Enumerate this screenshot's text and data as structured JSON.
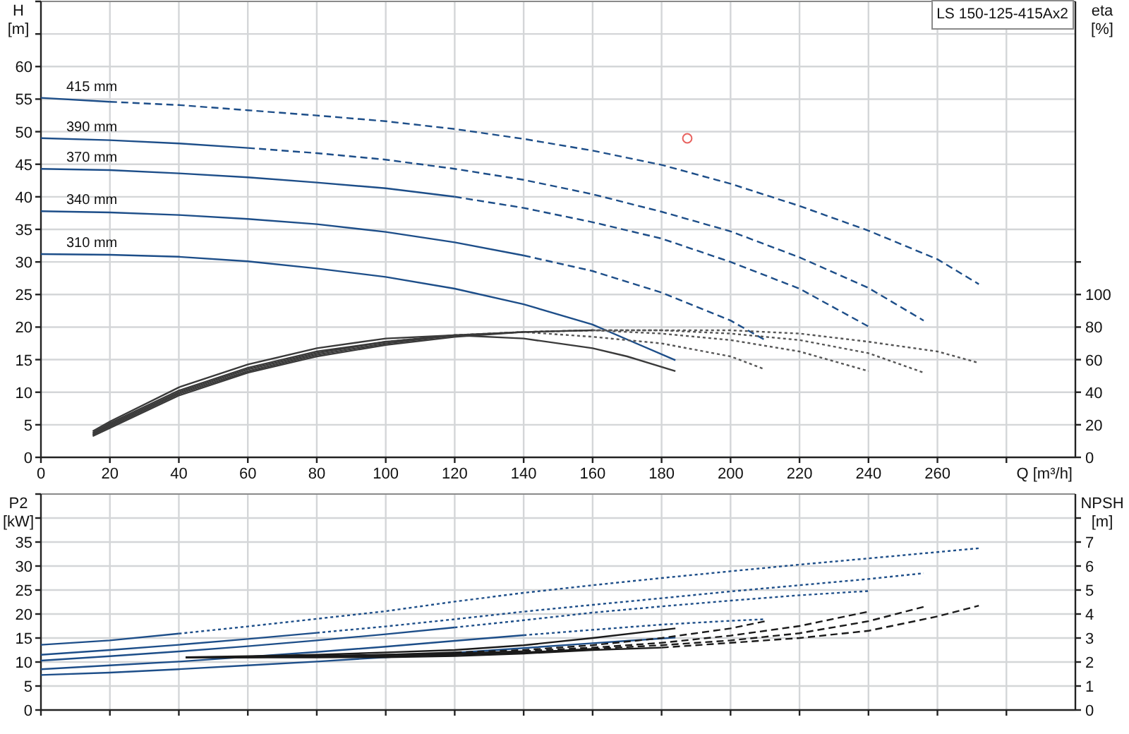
{
  "legend": "LS 150-125-415Ax2",
  "panels": [
    {
      "charts": [
        {
          "chart_data": {
            "type": "line",
            "xlabel": "Q [m³/h]",
            "ylabel": "H [m]",
            "grid": true,
            "xlim": [
              0,
              300
            ],
            "ylim": [
              0,
              70
            ],
            "xticks": [
              0,
              20,
              40,
              60,
              80,
              100,
              120,
              140,
              160,
              180,
              200,
              220,
              240,
              260
            ],
            "yticks": [
              0,
              5,
              10,
              15,
              20,
              25,
              30,
              35,
              40,
              45,
              50,
              55,
              60
            ],
            "series": [
              {
                "name": "415 mm",
                "color": "#1d4e89",
                "line_style": "solid",
                "x": [
                  0,
                  20
                ],
                "values": [
                  55.2,
                  54.6
                ]
              },
              {
                "color": "#1d4e89",
                "line_style": "dashed",
                "x": [
                  20,
                  40,
                  60,
                  80,
                  100,
                  120,
                  140,
                  160,
                  180,
                  200,
                  220,
                  240,
                  260,
                  272
                ],
                "values": [
                  54.6,
                  54.1,
                  53.3,
                  52.5,
                  51.6,
                  50.4,
                  48.9,
                  47.1,
                  44.9,
                  42.0,
                  38.6,
                  34.8,
                  30.4,
                  26.6
                ]
              },
              {
                "name": "390 mm",
                "color": "#1d4e89",
                "line_style": "solid",
                "x": [
                  0,
                  20,
                  40,
                  60
                ],
                "values": [
                  49.0,
                  48.7,
                  48.2,
                  47.5
                ]
              },
              {
                "color": "#1d4e89",
                "line_style": "dashed",
                "x": [
                  60,
                  80,
                  100,
                  120,
                  140,
                  160,
                  180,
                  200,
                  220,
                  240,
                  256
                ],
                "values": [
                  47.5,
                  46.7,
                  45.7,
                  44.3,
                  42.6,
                  40.4,
                  37.7,
                  34.7,
                  30.7,
                  26.0,
                  21.0
                ]
              },
              {
                "name": "370 mm",
                "color": "#1d4e89",
                "line_style": "solid",
                "x": [
                  0,
                  20,
                  40,
                  60,
                  80,
                  100,
                  120
                ],
                "values": [
                  44.3,
                  44.1,
                  43.6,
                  43.0,
                  42.2,
                  41.3,
                  40.0
                ]
              },
              {
                "color": "#1d4e89",
                "line_style": "dashed",
                "x": [
                  120,
                  140,
                  160,
                  180,
                  200,
                  220,
                  240
                ],
                "values": [
                  40.0,
                  38.3,
                  36.1,
                  33.6,
                  30.0,
                  25.9,
                  20.1
                ]
              },
              {
                "name": "340 mm",
                "color": "#1d4e89",
                "line_style": "solid",
                "x": [
                  0,
                  20,
                  40,
                  60,
                  80,
                  100,
                  120,
                  140
                ],
                "values": [
                  37.8,
                  37.6,
                  37.2,
                  36.6,
                  35.8,
                  34.6,
                  33.0,
                  31.0
                ]
              },
              {
                "color": "#1d4e89",
                "line_style": "dashed",
                "x": [
                  140,
                  160,
                  180,
                  200,
                  210
                ],
                "values": [
                  31.0,
                  28.6,
                  25.3,
                  21.0,
                  18.0
                ]
              },
              {
                "name": "310 mm",
                "color": "#1d4e89",
                "line_style": "solid",
                "x": [
                  0,
                  20,
                  40,
                  60,
                  80,
                  100,
                  120,
                  140,
                  160,
                  170,
                  184
                ],
                "values": [
                  31.2,
                  31.1,
                  30.8,
                  30.1,
                  29.0,
                  27.7,
                  25.9,
                  23.5,
                  20.4,
                  18.1,
                  14.9
                ]
              }
            ]
          }
        },
        {
          "chart_data": {
            "type": "line",
            "ylabel": "eta [%]",
            "xlim": [
              0,
              300
            ],
            "ylim": [
              0,
              280
            ],
            "yticks": [
              0,
              20,
              40,
              60,
              80,
              100
            ],
            "series": [
              {
                "color": "#3a3a3a",
                "line_style": "solid",
                "x": [
                  15,
                  20,
                  40,
                  60,
                  80,
                  100,
                  120,
                  140,
                  160,
                  170,
                  184
                ],
                "values": [
                  16,
                  22,
                  43,
                  57,
                  67,
                  73,
                  75,
                  73,
                  67,
                  62,
                  53
                ]
              },
              {
                "color": "#3a3a3a",
                "line_style": "solid",
                "x": [
                  15,
                  20,
                  40,
                  60,
                  80,
                  100
                ],
                "values": [
                  15,
                  21,
                  41,
                  55,
                  65,
                  71
                ]
              },
              {
                "color": "#555555",
                "line_style": "dotted",
                "x": [
                  100,
                  120,
                  140,
                  160,
                  180,
                  200,
                  210
                ],
                "values": [
                  71,
                  75,
                  77,
                  74,
                  70,
                  62,
                  54
                ]
              },
              {
                "color": "#3a3a3a",
                "line_style": "solid",
                "x": [
                  15,
                  20,
                  40,
                  60,
                  80,
                  100,
                  120
                ],
                "values": [
                  14,
                  20,
                  40,
                  54,
                  64,
                  71,
                  75
                ]
              },
              {
                "color": "#555555",
                "line_style": "dotted",
                "x": [
                  120,
                  140,
                  160,
                  180,
                  200,
                  220,
                  240
                ],
                "values": [
                  75,
                  77,
                  78,
                  76,
                  72,
                  65,
                  53
                ]
              },
              {
                "color": "#3a3a3a",
                "line_style": "solid",
                "x": [
                  15,
                  20,
                  40,
                  60,
                  80,
                  100,
                  120,
                  140
                ],
                "values": [
                  14,
                  19,
                  39,
                  53,
                  63,
                  70,
                  75,
                  77
                ]
              },
              {
                "color": "#555555",
                "line_style": "dotted",
                "x": [
                  140,
                  160,
                  180,
                  200,
                  220,
                  240,
                  256
                ],
                "values": [
                  77,
                  78,
                  78,
                  76,
                  72,
                  64,
                  52
                ]
              },
              {
                "color": "#3a3a3a",
                "line_style": "solid",
                "x": [
                  15,
                  20,
                  40,
                  60,
                  80,
                  100,
                  120,
                  140,
                  160
                ],
                "values": [
                  13,
                  18,
                  38,
                  52,
                  62,
                  69,
                  74,
                  77,
                  78
                ]
              },
              {
                "color": "#555555",
                "line_style": "dotted",
                "x": [
                  160,
                  180,
                  200,
                  220,
                  240,
                  260,
                  272
                ],
                "values": [
                  78,
                  78,
                  78,
                  76,
                  71,
                  65,
                  58
                ]
              }
            ]
          }
        }
      ]
    },
    {
      "charts": [
        {
          "chart_data": {
            "type": "line",
            "ylabel": "P2 [kW]",
            "grid": true,
            "xlim": [
              0,
              300
            ],
            "ylim": [
              0,
              45
            ],
            "yticks": [
              0,
              5,
              10,
              15,
              20,
              25,
              30,
              35
            ],
            "series": [
              {
                "color": "#1d4e89",
                "line_style": "solid",
                "x": [
                  0,
                  20,
                  40
                ],
                "values": [
                  13.6,
                  14.5,
                  15.9
                ]
              },
              {
                "color": "#1d4e89",
                "line_style": "dotted",
                "x": [
                  40,
                  60,
                  80,
                  100,
                  120,
                  140,
                  160,
                  180,
                  200,
                  220,
                  240,
                  260,
                  272
                ],
                "values": [
                  15.9,
                  17.4,
                  19.0,
                  20.6,
                  22.6,
                  24.4,
                  26.0,
                  27.5,
                  28.9,
                  30.3,
                  31.6,
                  32.9,
                  33.7
                ]
              },
              {
                "color": "#1d4e89",
                "line_style": "solid",
                "x": [
                  0,
                  20,
                  40,
                  60,
                  80
                ],
                "values": [
                  11.5,
                  12.5,
                  13.6,
                  14.8,
                  16.1
                ]
              },
              {
                "color": "#1d4e89",
                "line_style": "dotted",
                "x": [
                  80,
                  100,
                  120,
                  140,
                  160,
                  180,
                  200,
                  220,
                  240,
                  256
                ],
                "values": [
                  16.1,
                  17.4,
                  18.9,
                  20.5,
                  21.9,
                  23.3,
                  24.7,
                  26.0,
                  27.3,
                  28.5
                ]
              },
              {
                "color": "#1d4e89",
                "line_style": "solid",
                "x": [
                  0,
                  20,
                  40,
                  60,
                  80,
                  100,
                  120
                ],
                "values": [
                  10.3,
                  11.2,
                  12.2,
                  13.3,
                  14.5,
                  15.8,
                  17.2
                ]
              },
              {
                "color": "#1d4e89",
                "line_style": "dotted",
                "x": [
                  120,
                  140,
                  160,
                  180,
                  200,
                  220,
                  240
                ],
                "values": [
                  17.2,
                  18.7,
                  20.3,
                  21.6,
                  22.8,
                  23.9,
                  24.8
                ]
              },
              {
                "color": "#1d4e89",
                "line_style": "solid",
                "x": [
                  0,
                  20,
                  40,
                  60,
                  80,
                  100,
                  120,
                  140
                ],
                "values": [
                  8.5,
                  9.3,
                  10.1,
                  11.1,
                  12.1,
                  13.2,
                  14.4,
                  15.6
                ]
              },
              {
                "color": "#1d4e89",
                "line_style": "dotted",
                "x": [
                  140,
                  160,
                  180,
                  200,
                  210
                ],
                "values": [
                  15.6,
                  16.7,
                  17.8,
                  18.6,
                  18.9
                ]
              },
              {
                "color": "#1d4e89",
                "line_style": "solid",
                "x": [
                  0,
                  20,
                  40,
                  60,
                  80,
                  100,
                  120,
                  140,
                  160,
                  170,
                  184
                ],
                "values": [
                  7.3,
                  7.8,
                  8.5,
                  9.3,
                  10.1,
                  11.0,
                  11.9,
                  12.9,
                  13.9,
                  14.4,
                  15.1
                ]
              }
            ]
          }
        },
        {
          "chart_data": {
            "type": "line",
            "ylabel": "NPSH [m]",
            "xlim": [
              0,
              300
            ],
            "ylim": [
              0,
              9
            ],
            "yticks": [
              0,
              1,
              2,
              3,
              4,
              5,
              6,
              7
            ],
            "series": [
              {
                "color": "#1a1a1a",
                "line_style": "solid",
                "x": [
                  42,
                  60,
                  80,
                  100,
                  120,
                  140,
                  160,
                  184
                ],
                "values": [
                  2.2,
                  2.25,
                  2.3,
                  2.4,
                  2.5,
                  2.7,
                  3.0,
                  3.4
                ]
              },
              {
                "color": "#1a1a1a",
                "line_style": "solid",
                "x": [
                  42,
                  60,
                  80,
                  100,
                  120
                ],
                "values": [
                  2.2,
                  2.2,
                  2.25,
                  2.3,
                  2.4
                ]
              },
              {
                "color": "#1a1a1a",
                "line_style": "dashed",
                "x": [
                  120,
                  140,
                  160,
                  180,
                  200,
                  210
                ],
                "values": [
                  2.4,
                  2.5,
                  2.7,
                  3.0,
                  3.4,
                  3.7
                ]
              },
              {
                "color": "#1a1a1a",
                "line_style": "solid",
                "x": [
                  42,
                  60,
                  80,
                  100,
                  120,
                  140
                ],
                "values": [
                  2.2,
                  2.2,
                  2.25,
                  2.3,
                  2.35,
                  2.45
                ]
              },
              {
                "color": "#1a1a1a",
                "line_style": "dashed",
                "x": [
                  140,
                  160,
                  180,
                  200,
                  220,
                  240
                ],
                "values": [
                  2.45,
                  2.6,
                  2.8,
                  3.1,
                  3.5,
                  4.1
                ]
              },
              {
                "color": "#1a1a1a",
                "line_style": "solid",
                "x": [
                  42,
                  60,
                  80,
                  100,
                  120,
                  140,
                  160
                ],
                "values": [
                  2.2,
                  2.2,
                  2.2,
                  2.25,
                  2.3,
                  2.4,
                  2.55
                ]
              },
              {
                "color": "#1a1a1a",
                "line_style": "dashed",
                "x": [
                  160,
                  180,
                  200,
                  220,
                  240,
                  256
                ],
                "values": [
                  2.55,
                  2.7,
                  2.9,
                  3.2,
                  3.7,
                  4.3
                ]
              },
              {
                "color": "#1a1a1a",
                "line_style": "solid",
                "x": [
                  42,
                  60,
                  80,
                  100,
                  120,
                  140,
                  160,
                  180
                ],
                "values": [
                  2.2,
                  2.2,
                  2.2,
                  2.2,
                  2.25,
                  2.35,
                  2.5,
                  2.6
                ]
              },
              {
                "color": "#1a1a1a",
                "line_style": "dashed",
                "x": [
                  180,
                  200,
                  220,
                  240,
                  260,
                  272
                ],
                "values": [
                  2.6,
                  2.8,
                  3.0,
                  3.3,
                  3.9,
                  4.35
                ]
              }
            ]
          }
        }
      ]
    }
  ]
}
